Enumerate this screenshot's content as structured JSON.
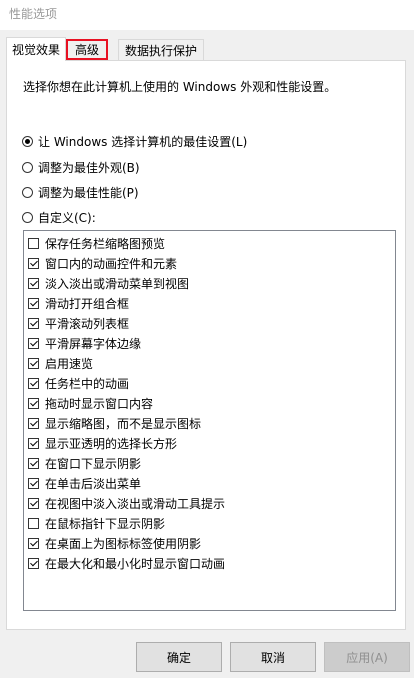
{
  "window": {
    "title": "性能选项"
  },
  "tabs": [
    {
      "label": "视觉效果",
      "active": true
    },
    {
      "label": "高级",
      "active": false,
      "highlighted": true
    },
    {
      "label": "数据执行保护",
      "active": false
    }
  ],
  "visual": {
    "intro": "选择你想在此计算机上使用的 Windows 外观和性能设置。",
    "options": [
      {
        "label": "让 Windows 选择计算机的最佳设置(L)",
        "checked": true
      },
      {
        "label": "调整为最佳外观(B)",
        "checked": false
      },
      {
        "label": "调整为最佳性能(P)",
        "checked": false
      },
      {
        "label": "自定义(C):",
        "checked": false
      }
    ],
    "effects": [
      {
        "label": "保存任务栏缩略图预览",
        "checked": false
      },
      {
        "label": "窗口内的动画控件和元素",
        "checked": true
      },
      {
        "label": "淡入淡出或滑动菜单到视图",
        "checked": true
      },
      {
        "label": "滑动打开组合框",
        "checked": true
      },
      {
        "label": "平滑滚动列表框",
        "checked": true
      },
      {
        "label": "平滑屏幕字体边缘",
        "checked": true
      },
      {
        "label": "启用速览",
        "checked": true
      },
      {
        "label": "任务栏中的动画",
        "checked": true
      },
      {
        "label": "拖动时显示窗口内容",
        "checked": true
      },
      {
        "label": "显示缩略图，而不是显示图标",
        "checked": true
      },
      {
        "label": "显示亚透明的选择长方形",
        "checked": true
      },
      {
        "label": "在窗口下显示阴影",
        "checked": true
      },
      {
        "label": "在单击后淡出菜单",
        "checked": true
      },
      {
        "label": "在视图中淡入淡出或滑动工具提示",
        "checked": true
      },
      {
        "label": "在鼠标指针下显示阴影",
        "checked": false
      },
      {
        "label": "在桌面上为图标标签使用阴影",
        "checked": true
      },
      {
        "label": "在最大化和最小化时显示窗口动画",
        "checked": true
      }
    ]
  },
  "buttons": {
    "ok": "确定",
    "cancel": "取消",
    "apply": "应用(A)"
  },
  "colors": {
    "highlight": "#e81123",
    "panel_bg": "#ffffff",
    "window_bg": "#f0f0f0"
  }
}
